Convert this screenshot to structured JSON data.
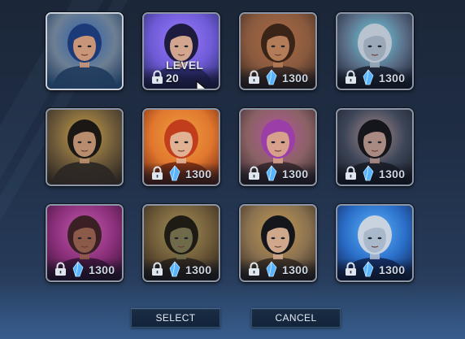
{
  "screen": "character-portrait-select",
  "portraits": [
    {
      "id": "p1",
      "palette": [
        "#1e3a5c",
        "#6d7f93",
        "#2d5fa8"
      ],
      "hair": "#1c3a78",
      "skin": "#c99579",
      "locked": false,
      "selected": true
    },
    {
      "id": "p2",
      "palette": [
        "#2a2a6a",
        "#6f5bd6",
        "#9b7bff"
      ],
      "hair": "#1d1b3e",
      "skin": "#d2a58e",
      "locked": true,
      "requirement": {
        "type": "level",
        "text": "LEVEL 20"
      }
    },
    {
      "id": "p3",
      "palette": [
        "#3b2a22",
        "#8a5a3e",
        "#a86b46"
      ],
      "hair": "#3a2418",
      "skin": "#b37c58",
      "locked": true,
      "cost": "1300"
    },
    {
      "id": "p4",
      "palette": [
        "#1b2233",
        "#5a6c86",
        "#6fd3e6"
      ],
      "hair": "#b9c3cf",
      "skin": "#9aa8b8",
      "locked": true,
      "cost": "1300"
    },
    {
      "id": "p5",
      "palette": [
        "#2a2623",
        "#6e5a3a",
        "#caa24a"
      ],
      "hair": "#1a1715",
      "skin": "#b88d6e",
      "locked": false
    },
    {
      "id": "p6",
      "palette": [
        "#7a2a12",
        "#e0772e",
        "#f0a040"
      ],
      "hair": "#c13d1c",
      "skin": "#e0b193",
      "locked": true,
      "cost": "1300"
    },
    {
      "id": "p7",
      "palette": [
        "#3a2a2e",
        "#8a6264",
        "#b6559e"
      ],
      "hair": "#9b3ea8",
      "skin": "#d6a08c",
      "locked": true,
      "cost": "1300"
    },
    {
      "id": "p8",
      "palette": [
        "#1b1e28",
        "#3c4558",
        "#a58a8a"
      ],
      "hair": "#14161c",
      "skin": "#a88a82",
      "locked": true,
      "cost": "1300"
    },
    {
      "id": "p9",
      "palette": [
        "#3a1538",
        "#8b2f7a",
        "#c25bb0"
      ],
      "hair": "#3a2024",
      "skin": "#8c5a48",
      "locked": true,
      "cost": "1300"
    },
    {
      "id": "p10",
      "palette": [
        "#2b241c",
        "#6e5a38",
        "#a3925a"
      ],
      "hair": "#1e1a14",
      "skin": "#6f6a4a",
      "locked": true,
      "cost": "1300"
    },
    {
      "id": "p11",
      "palette": [
        "#3a2e22",
        "#8a7150",
        "#c49a52"
      ],
      "hair": "#15161c",
      "skin": "#cfa78b",
      "locked": true,
      "cost": "1300"
    },
    {
      "id": "p12",
      "palette": [
        "#13285a",
        "#2a6ec8",
        "#5fb6ff"
      ],
      "hair": "#c9d3e0",
      "skin": "#aab8cc",
      "locked": true,
      "cost": "1300"
    }
  ],
  "buttons": {
    "select_label": "SELECT",
    "cancel_label": "CANCEL"
  },
  "colors": {
    "shard_fill": "#58b4ff",
    "shard_stroke": "#b9e4ff",
    "lock_fill": "#dfe6ee",
    "border": "#8d96a6"
  }
}
